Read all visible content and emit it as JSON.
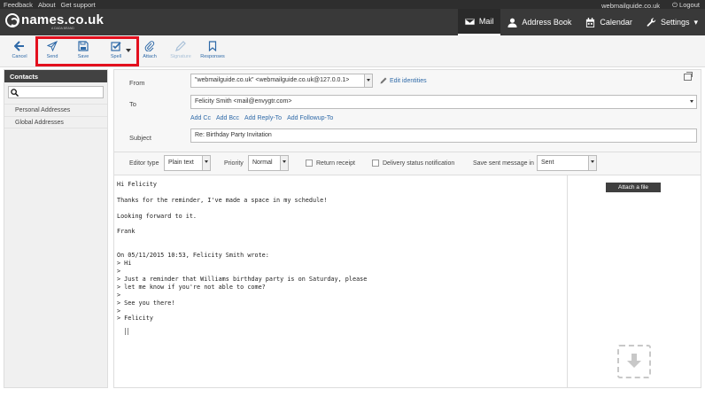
{
  "topbar": {
    "links": [
      "Feedback",
      "About",
      "Get support"
    ],
    "domain": "webmailguide.co.uk",
    "logout": "Logout"
  },
  "header": {
    "logo_text": "names.co.uk",
    "logo_sub": "A DADA BRAND",
    "nav": [
      {
        "label": "Mail",
        "icon": "envelope-icon",
        "active": true
      },
      {
        "label": "Address Book",
        "icon": "person-icon"
      },
      {
        "label": "Calendar",
        "icon": "calendar-icon"
      },
      {
        "label": "Settings",
        "icon": "wrench-icon"
      }
    ]
  },
  "toolbar": {
    "cancel": "Cancel",
    "send": "Send",
    "save": "Save",
    "spell": "Spell",
    "attach": "Attach",
    "signature": "Signature",
    "responses": "Responses"
  },
  "sidebar": {
    "title": "Contacts",
    "search_placeholder": "",
    "items": [
      "Personal Addresses",
      "Global Addresses"
    ]
  },
  "compose": {
    "from_label": "From",
    "from_value": "\"webmailguide.co.uk\" <webmailguide.co.uk@127.0.0.1>",
    "edit_identities": "Edit identities",
    "to_label": "To",
    "to_value": "Felicity Smith <mail@envygtr.com>",
    "add_links": [
      "Add Cc",
      "Add Bcc",
      "Add Reply-To",
      "Add Followup-To"
    ],
    "subject_label": "Subject",
    "subject_value": "Re: Birthday Party Invitation"
  },
  "options": {
    "editor_type_label": "Editor type",
    "editor_type_value": "Plain text",
    "priority_label": "Priority",
    "priority_value": "Normal",
    "return_receipt": "Return receipt",
    "delivery_status": "Delivery status notification",
    "save_sent_label": "Save sent message in",
    "save_sent_value": "Sent"
  },
  "body": {
    "text": "Hi Felicity\n\nThanks for the reminder, I've made a space in my schedule!\n\nLooking forward to it.\n\nFrank\n\n\nOn 05/11/2015 10:53, Felicity Smith wrote:\n> Hi\n>\n> Just a reminder that Williams birthday party is on Saturday, please\n> let me know if you're not able to come?\n>\n> See you there!\n>\n> Felicity"
  },
  "attachments": {
    "attach_button": "Attach a file"
  },
  "colors": {
    "accent": "#2f6aa8",
    "header_bg": "#393939",
    "highlight": "#e3101e"
  }
}
